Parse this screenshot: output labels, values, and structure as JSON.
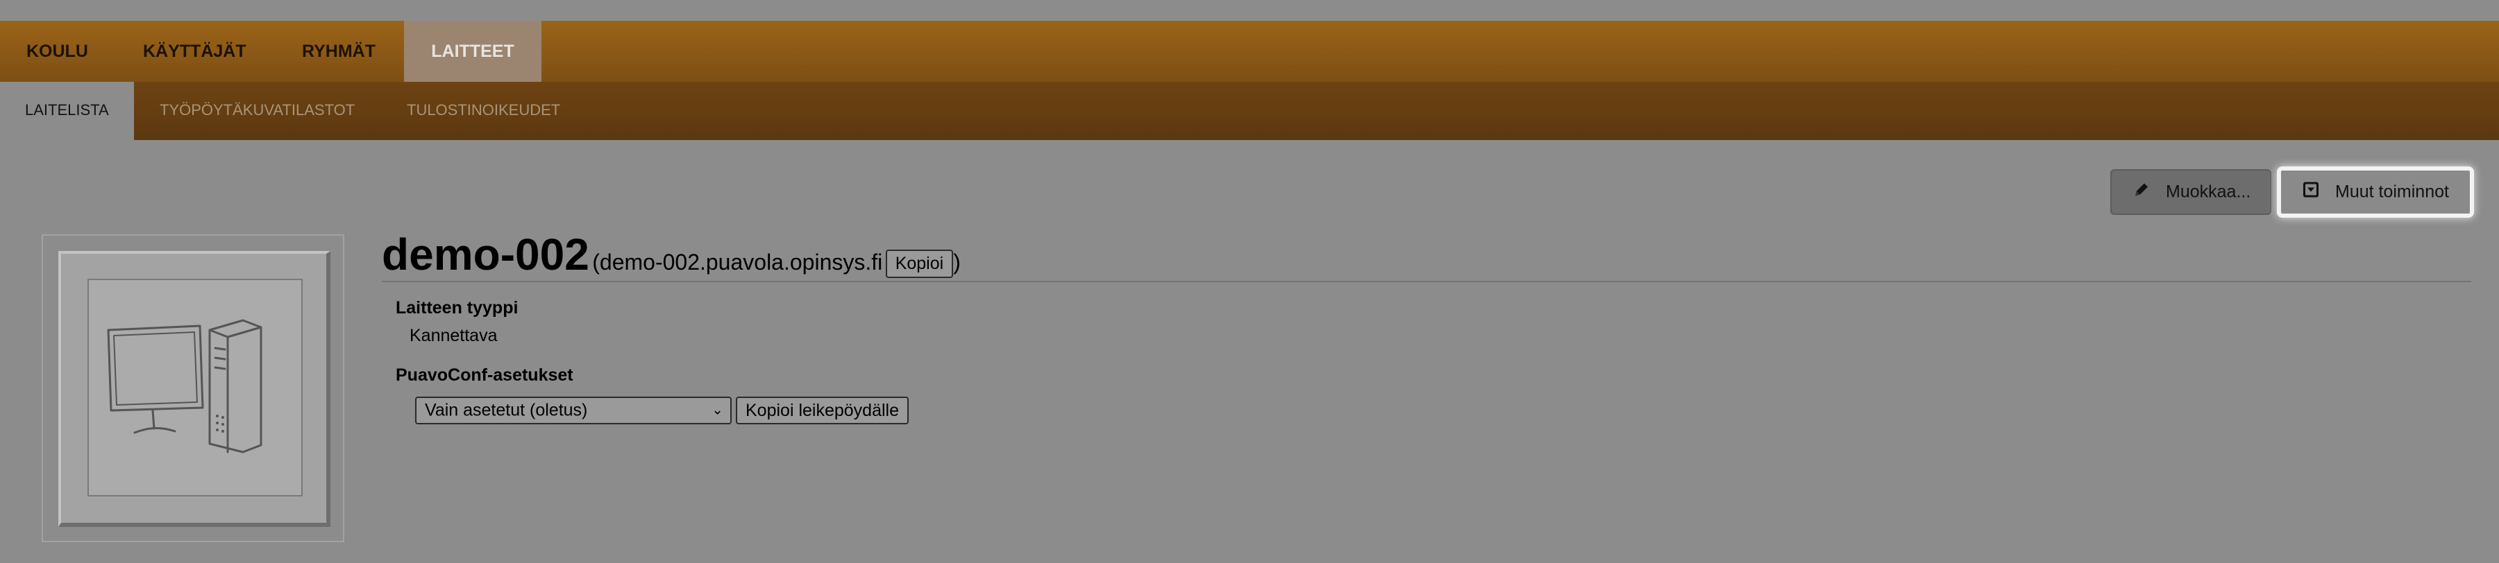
{
  "main_nav": {
    "tabs": [
      {
        "label": "KOULU",
        "active": false
      },
      {
        "label": "KÄYTTÄJÄT",
        "active": false
      },
      {
        "label": "RYHMÄT",
        "active": false
      },
      {
        "label": "LAITTEET",
        "active": true
      }
    ]
  },
  "sub_nav": {
    "tabs": [
      {
        "label": "LAITELISTA",
        "active": true
      },
      {
        "label": "TYÖPÖYTÄKUVATILASTOT",
        "active": false
      },
      {
        "label": "TULOSTINOIKEUDET",
        "active": false
      }
    ]
  },
  "actions": {
    "edit_label": "Muokkaa...",
    "edit_icon": "pencil-icon",
    "other_label": "Muut toiminnot",
    "other_icon": "dropdown-menu-icon"
  },
  "device": {
    "image_icon": "desktop-computer-icon",
    "hostname": "demo-002",
    "paren_open": "(",
    "fqdn": "demo-002.puavola.opinsys.fi",
    "copy_label": "Kopioi",
    "paren_close": ")",
    "type_label": "Laitteen tyyppi",
    "type_value": "Kannettava",
    "puavoconf_label": "PuavoConf-asetukset",
    "puavoconf_select_value": "Vain asetetut (oletus)",
    "clipboard_button": "Kopioi leikepöydälle"
  },
  "colors": {
    "main_nav_bg": "#8a5a17",
    "sub_nav_bg": "#653e11",
    "active_main_tab": "#9b8570",
    "page_bg": "#8c8c8c"
  }
}
